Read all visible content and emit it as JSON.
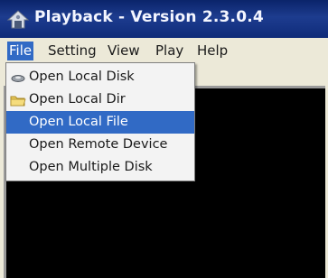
{
  "window": {
    "title": "Playback - Version 2.3.0.4"
  },
  "menubar": {
    "items": [
      {
        "label": "File",
        "active": true
      },
      {
        "label": "Setting"
      },
      {
        "label": "View"
      },
      {
        "label": "Play"
      },
      {
        "label": "Help"
      }
    ]
  },
  "file_menu": {
    "items": [
      {
        "label": "Open Local Disk",
        "icon": "disk-icon"
      },
      {
        "label": "Open Local Dir",
        "icon": "folder-icon"
      },
      {
        "label": "Open Local File",
        "highlighted": true
      },
      {
        "label": "Open Remote Device"
      },
      {
        "label": "Open Multiple Disk"
      }
    ]
  },
  "colors": {
    "titlebar": "#0a246a",
    "menu_highlight": "#316ac5",
    "video_background": "#000000"
  }
}
